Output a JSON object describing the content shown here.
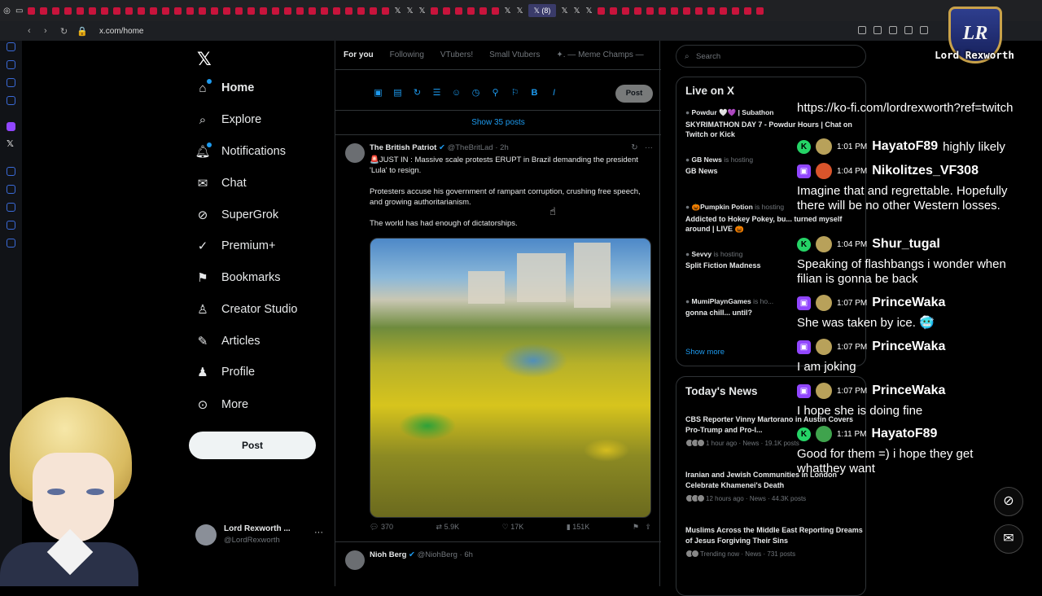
{
  "browser": {
    "url": "x.com/home",
    "active_tab_label": "(8)"
  },
  "nav": {
    "items": [
      {
        "label": "Home"
      },
      {
        "label": "Explore"
      },
      {
        "label": "Notifications"
      },
      {
        "label": "Chat"
      },
      {
        "label": "SuperGrok"
      },
      {
        "label": "Premium+"
      },
      {
        "label": "Bookmarks"
      },
      {
        "label": "Creator Studio"
      },
      {
        "label": "Articles"
      },
      {
        "label": "Profile"
      },
      {
        "label": "More"
      }
    ],
    "post_label": "Post",
    "account": {
      "name": "Lord Rexworth ...",
      "handle": "@LordRexworth"
    }
  },
  "feed": {
    "tabs": [
      "For you",
      "Following",
      "VTubers!",
      "Small Vtubers",
      "✦. — Meme Champs —"
    ],
    "composer_post": "Post",
    "show_posts": "Show 35 posts",
    "tweet": {
      "name": "The British Patriot",
      "handle": "@TheBritLad",
      "time": "· 2h",
      "body": [
        "🚨JUST IN : Massive scale protests ERUPT in Brazil demanding the president 'Lula' to resign.",
        "Protesters accuse his government of rampant corruption, crushing free speech, and growing authoritarianism.",
        "The world has had enough of dictatorships."
      ],
      "replies": "370",
      "reposts": "5.9K",
      "likes": "17K",
      "views": "151K"
    },
    "tweet2": {
      "name": "Nioh Berg",
      "handle": "@NiohBerg",
      "time": "· 6h"
    }
  },
  "right": {
    "search_placeholder": "Search",
    "live_title": "Live on X",
    "live": [
      {
        "host": "Powdur 🤍💜 | Subathon",
        "status": "",
        "title": "SKYRIMATHON DAY 7 - Powdur Hours | Chat on Twitch or Kick"
      },
      {
        "host": "GB News",
        "status": "is hosting",
        "title": "GB News"
      },
      {
        "host": "🎃Pumpkin Potion",
        "status": "is hosting",
        "title": "Addicted to Hokey Pokey, bu... turned myself around | LIVE 🎃"
      },
      {
        "host": "Sevvy",
        "status": "is hosting",
        "title": "Split Fiction Madness"
      },
      {
        "host": "MumiPlaynGames",
        "status": "is ho...",
        "title": "gonna chill... until?"
      }
    ],
    "live_more": "Show more",
    "news_title": "Today's News",
    "news": [
      {
        "title": "CBS Reporter Vinny Martorano in Austin Covers Pro-Trump and Pro-I...",
        "meta": "1 hour ago · News · 19.1K posts"
      },
      {
        "title": "Iranian and Jewish Communities in London Celebrate Khamenei's Death",
        "meta": "12 hours ago · News · 44.3K posts"
      },
      {
        "title": "Muslims Across the Middle East Reporting Dreams of Jesus Forgiving Their Sins",
        "meta": "Trending now · News · 731 posts"
      }
    ]
  },
  "overlay": {
    "channel_name": "Lord Rexworth",
    "monogram": "LR",
    "chat": [
      {
        "platform": "",
        "time": "",
        "user": "",
        "inline": "",
        "text": "https://ko-fi.com/lordrexworth?ref=twitch"
      },
      {
        "platform": "kick",
        "time": "1:01 PM",
        "user": "HayatoF89",
        "inline": "highly likely",
        "text": ""
      },
      {
        "platform": "twitch",
        "time": "1:04 PM",
        "user": "Nikolitzes_VF308",
        "inline": "",
        "text": "Imagine that and regrettable. Hopefully there will be no other Western losses."
      },
      {
        "platform": "kick",
        "time": "1:04 PM",
        "user": "Shur_tugal",
        "inline": "",
        "text": "Speaking of flashbangs i wonder when filian is gonna be back"
      },
      {
        "platform": "twitch",
        "time": "1:07 PM",
        "user": "PrinceWaka",
        "inline": "",
        "text": "She was taken by ice. 🥶"
      },
      {
        "platform": "twitch",
        "time": "1:07 PM",
        "user": "PrinceWaka",
        "inline": "",
        "text": "I am joking"
      },
      {
        "platform": "twitch",
        "time": "1:07 PM",
        "user": "PrinceWaka",
        "inline": "",
        "text": "I hope she is doing fine"
      },
      {
        "platform": "kick",
        "time": "1:11 PM",
        "user": "HayatoF89",
        "inline": "",
        "text": "Good for them =) i hope they get whatthey want"
      }
    ]
  },
  "colors": {
    "accent": "#1d9bf0",
    "twitch": "#9146ff",
    "kick": "#25d366",
    "tab_red": "#c8143c"
  }
}
